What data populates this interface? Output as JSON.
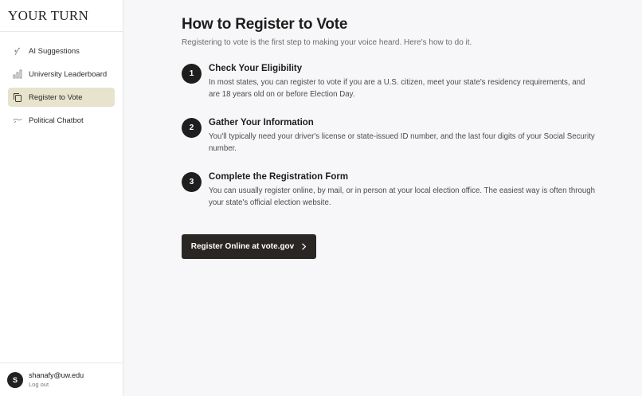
{
  "app": {
    "brand": "YOUR TURN"
  },
  "sidebar": {
    "items": [
      {
        "label": "AI Suggestions",
        "icon": "sparkle-pen-icon",
        "active": false
      },
      {
        "label": "University Leaderboard",
        "icon": "bar-chart-icon",
        "active": false
      },
      {
        "label": "Register to Vote",
        "icon": "documents-icon",
        "active": true
      },
      {
        "label": "Political Chatbot",
        "icon": "chat-icon",
        "active": false
      }
    ]
  },
  "user": {
    "initial": "S",
    "email": "shanafy@uw.edu",
    "logout_label": "Log out"
  },
  "main": {
    "title": "How to Register to Vote",
    "subtitle": "Registering to vote is the first step to making your voice heard. Here's how to do it.",
    "steps": [
      {
        "number": "1",
        "title": "Check Your Eligibility",
        "description": "In most states, you can register to vote if you are a U.S. citizen, meet your state's residency requirements, and are 18 years old on or before Election Day."
      },
      {
        "number": "2",
        "title": "Gather Your Information",
        "description": "You'll typically need your driver's license or state-issued ID number, and the last four digits of your Social Security number."
      },
      {
        "number": "3",
        "title": "Complete the Registration Form",
        "description": "You can usually register online, by mail, or in person at your local election office. The easiest way is often through your state's official election website."
      }
    ],
    "cta_label": "Register Online at vote.gov",
    "cta_icon": "chevron-right-icon"
  },
  "colors": {
    "active_nav": "#e7e3cc",
    "button_bg": "#2a2624",
    "page_bg": "#f7f7f9"
  }
}
